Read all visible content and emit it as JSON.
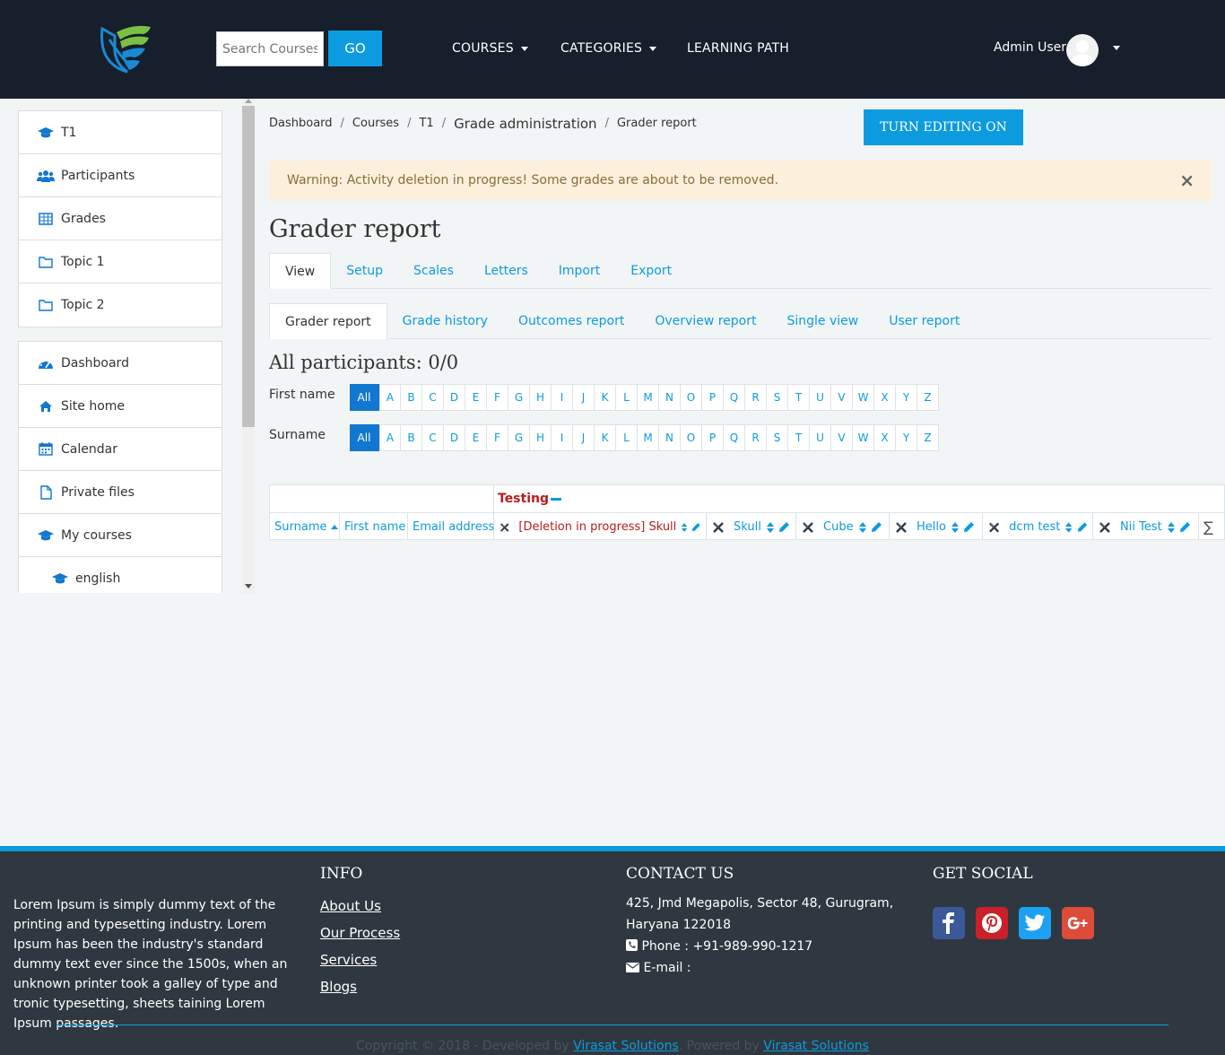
{
  "header": {
    "search_placeholder": "Search Courses",
    "go_label": "GO",
    "nav": [
      {
        "label": "COURSES"
      },
      {
        "label": "CATEGORIES"
      },
      {
        "label": "LEARNING PATH"
      }
    ],
    "user_name": "Admin User"
  },
  "sidebar": {
    "course_items": [
      {
        "label": "T1",
        "icon": "graduation-cap-icon"
      },
      {
        "label": "Participants",
        "icon": "users-icon"
      },
      {
        "label": "Grades",
        "icon": "table-icon"
      },
      {
        "label": "Topic 1",
        "icon": "folder-icon"
      },
      {
        "label": "Topic 2",
        "icon": "folder-icon"
      }
    ],
    "nav_items": [
      {
        "label": "Dashboard",
        "icon": "dashboard-icon"
      },
      {
        "label": "Site home",
        "icon": "home-icon"
      },
      {
        "label": "Calendar",
        "icon": "calendar-icon"
      },
      {
        "label": "Private files",
        "icon": "file-icon"
      },
      {
        "label": "My courses",
        "icon": "graduation-cap-icon"
      },
      {
        "label": "english",
        "icon": "graduation-cap-icon"
      }
    ]
  },
  "breadcrumb": [
    "Dashboard",
    "Courses",
    "T1",
    "Grade administration",
    "Grader report"
  ],
  "edit_button": "TURN EDITING ON",
  "alert": {
    "text": "Warning: Activity deletion in progress! Some grades are about to be removed.",
    "close": "×"
  },
  "page_title": "Grader report",
  "tabs_primary": [
    "View",
    "Setup",
    "Scales",
    "Letters",
    "Import",
    "Export"
  ],
  "tabs_secondary": [
    "Grader report",
    "Grade history",
    "Outcomes report",
    "Overview report",
    "Single view",
    "User report"
  ],
  "participants_heading": "All participants: 0/0",
  "filters": {
    "first_name_label": "First name",
    "surname_label": "Surname",
    "letters": [
      "All",
      "A",
      "B",
      "C",
      "D",
      "E",
      "F",
      "G",
      "H",
      "I",
      "J",
      "K",
      "L",
      "M",
      "N",
      "O",
      "P",
      "Q",
      "R",
      "S",
      "T",
      "U",
      "V",
      "W",
      "X",
      "Y",
      "Z"
    ]
  },
  "grade_table": {
    "category": "Testing",
    "user_columns": [
      "Surname",
      "First name",
      "Email address"
    ],
    "items": [
      {
        "label": "[Deletion in progress] Skull"
      },
      {
        "label": "Skull"
      },
      {
        "label": "Cube"
      },
      {
        "label": "Hello"
      },
      {
        "label": "dcm test"
      },
      {
        "label": "Nii Test"
      }
    ],
    "total_symbol": "∑"
  },
  "footer": {
    "about_text": "Lorem Ipsum is simply dummy text of the printing and typesetting industry. Lorem Ipsum has been the industry's standard dummy text ever since the 1500s, when an unknown printer took a galley of type and tronic typesetting, sheets taining Lorem Ipsum passages.",
    "info_heading": "INFO",
    "info_links": [
      "About Us",
      "Our Process",
      "Services",
      "Blogs"
    ],
    "contact_heading": "CONTACT US",
    "address_line1": "425, Jmd Megapolis, Sector 48, Gurugram,",
    "address_line2": "Haryana 122018",
    "phone": "Phone : +91-989-990-1217",
    "email": "E-mail :",
    "social_heading": "GET SOCIAL",
    "social": [
      {
        "name": "facebook",
        "color": "#3b5998"
      },
      {
        "name": "pinterest",
        "color": "#cb2027"
      },
      {
        "name": "twitter",
        "color": "#1da1f2"
      },
      {
        "name": "google-plus",
        "color": "#dd4b39"
      }
    ],
    "copyright_prefix": "Copyright © 2018 - Developed by ",
    "developer": "Virasat Solutions",
    "powered_prefix": ". Powered by ",
    "powered": "Virasat Solutions"
  }
}
